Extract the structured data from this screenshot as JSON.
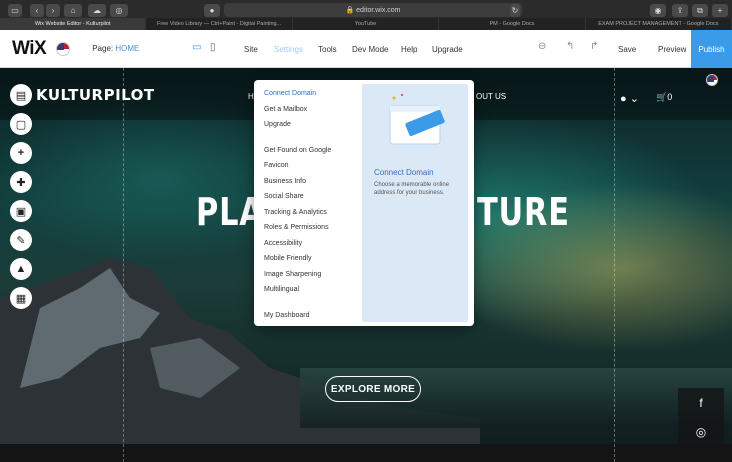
{
  "browser": {
    "url": "editor.wix.com",
    "tabs": [
      "Wix Website Editor - Kulturpilot",
      "Free Video Library — Ctrl+Paint - Digital Painting...",
      "YouTube",
      "PM - Google Docs",
      "EXAM PROJECT MANAGEMENT - Google Docs"
    ]
  },
  "wix": {
    "logo": "WiX",
    "page_label": "Page:",
    "page_name": "HOME",
    "menu": [
      "Site",
      "Settings",
      "Tools",
      "Dev Mode",
      "Help",
      "Upgrade"
    ],
    "save": "Save",
    "preview": "Preview",
    "publish": "Publish"
  },
  "site": {
    "logo": "KULTURPILOT",
    "nav_left_frag": "H",
    "nav_right_frag": "OUT US",
    "cart_count": "0",
    "hero_left": "PLA",
    "hero_right": "TURE",
    "explore": "EXPLORE MORE"
  },
  "settings_menu": {
    "items": [
      "Connect Domain",
      "Get a Mailbox",
      "Upgrade",
      "Get Found on Google",
      "Favicon",
      "Business Info",
      "Social Share",
      "Tracking & Analytics",
      "Roles & Permissions",
      "Accessibility",
      "Mobile Friendly",
      "Image Sharpening",
      "Multilingual",
      "My Dashboard"
    ],
    "panel_title": "Connect Domain",
    "panel_desc": "Choose a memorable online address for your business."
  },
  "colors": {
    "accent": "#3b9be8",
    "active_menu": "#9ecbf4"
  },
  "icons": [
    "facebook-icon",
    "instagram-icon",
    "user-icon",
    "cart-icon",
    "desktop-icon",
    "mobile-icon",
    "undo-icon",
    "redo-icon",
    "zoom-icon"
  ]
}
